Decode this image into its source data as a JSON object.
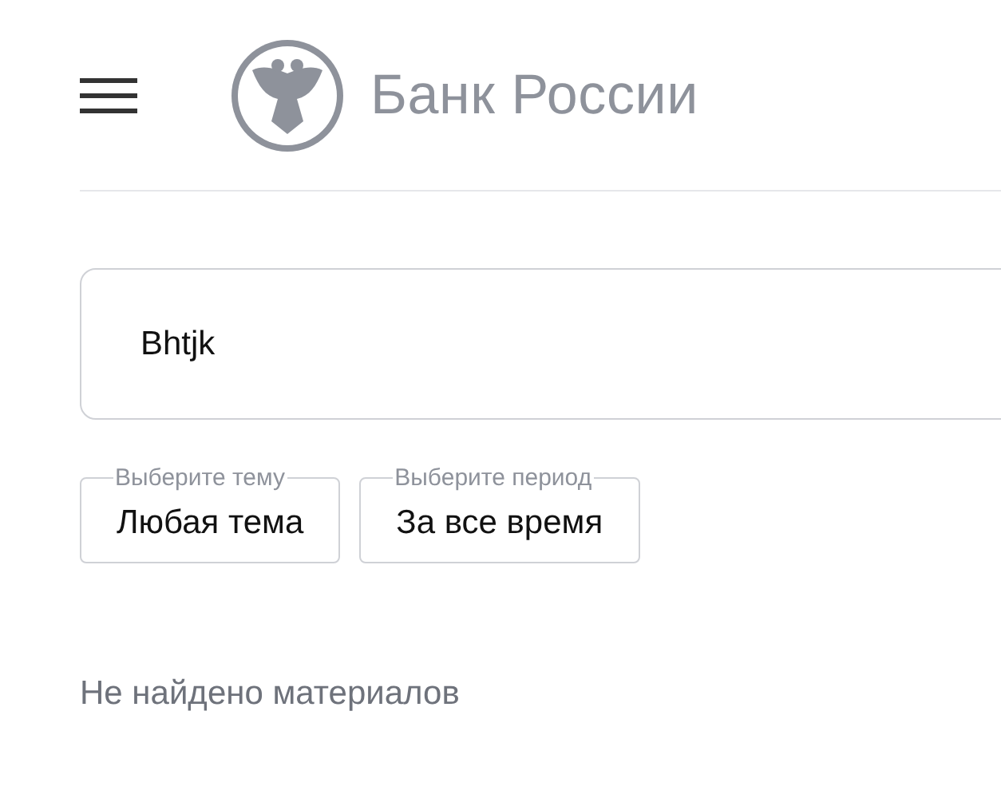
{
  "header": {
    "brand": "Банк России"
  },
  "search": {
    "value": "Bhtjk"
  },
  "filters": [
    {
      "label": "Выберите тему",
      "value": "Любая тема"
    },
    {
      "label": "Выберите период",
      "value": "За все время"
    }
  ],
  "message": "Не найдено материалов"
}
